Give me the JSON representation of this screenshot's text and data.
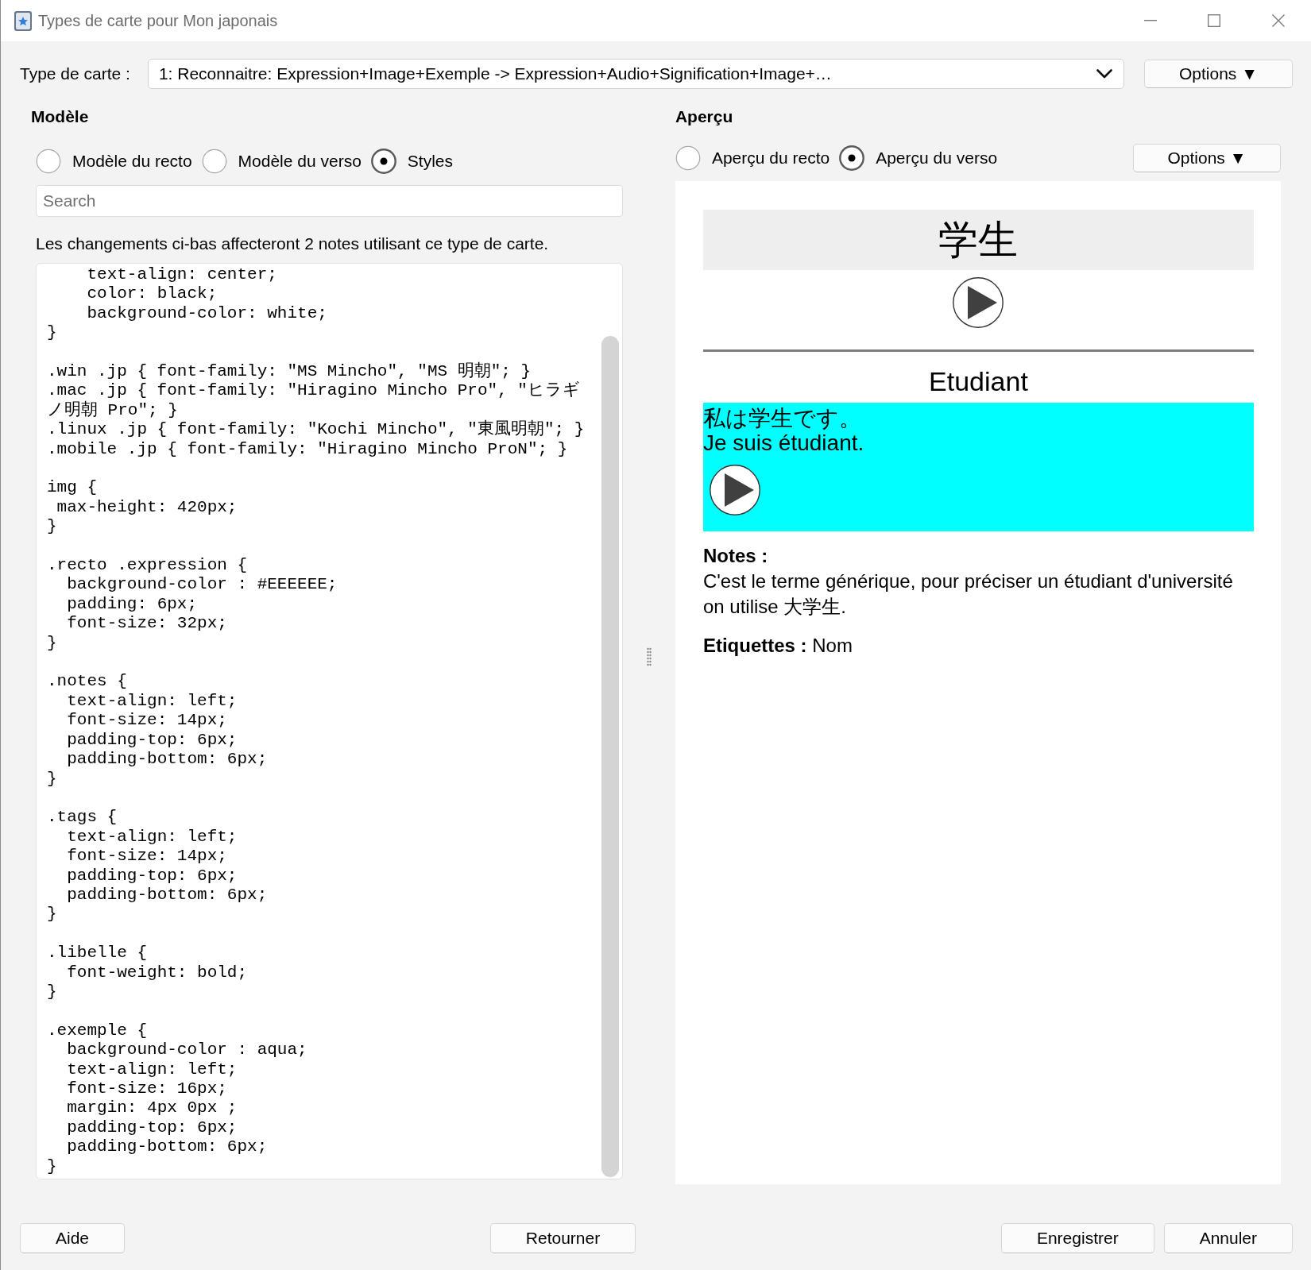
{
  "window": {
    "title": "Types de carte pour Mon japonais"
  },
  "card_type": {
    "label": "Type de carte :",
    "value": "1: Reconnaitre: Expression+Image+Exemple -> Expression+Audio+Signification+Image+…",
    "options_button": "Options ▼"
  },
  "template": {
    "heading": "Modèle",
    "modes": [
      {
        "label": "Modèle du recto",
        "selected": false
      },
      {
        "label": "Modèle du verso",
        "selected": false
      },
      {
        "label": "Styles",
        "selected": true
      }
    ],
    "search": {
      "placeholder": "Search"
    },
    "info": "Les changements ci-bas affecteront 2 notes utilisant ce type de carte.",
    "code_blocks": [
      [
        "    text-align: center;",
        "    color: black;",
        "    background-color: white;",
        "}"
      ],
      [
        ".win .jp { font-family: \"MS Mincho\", \"MS 明朝\"; }",
        ".mac .jp { font-family: \"Hiragino Mincho Pro\", \"ヒラギノ明朝 Pro\"; }",
        ".linux .jp { font-family: \"Kochi Mincho\", \"東風明朝\"; }",
        ".mobile .jp { font-family: \"Hiragino Mincho ProN\"; }"
      ],
      [
        "img {",
        " max-height: 420px;",
        "}"
      ],
      [
        ".recto .expression {",
        "  background-color : #EEEEEE;",
        "  padding: 6px;",
        "  font-size: 32px;",
        "}"
      ],
      [
        ".notes {",
        "  text-align: left;",
        "  font-size: 14px;",
        "  padding-top: 6px;",
        "  padding-bottom: 6px;",
        "}"
      ],
      [
        ".tags {",
        "  text-align: left;",
        "  font-size: 14px;",
        "  padding-top: 6px;",
        "  padding-bottom: 6px;",
        "}"
      ],
      [
        ".libelle {",
        "  font-weight: bold;",
        "}"
      ],
      [
        ".exemple {",
        "  background-color : aqua;",
        "  text-align: left;",
        "  font-size: 16px;",
        "  margin: 4px 0px ;",
        "  padding-top: 6px;",
        "  padding-bottom: 6px;",
        "}"
      ]
    ]
  },
  "preview": {
    "heading": "Aperçu",
    "modes": [
      {
        "label": "Aperçu du recto",
        "selected": false
      },
      {
        "label": "Aperçu du verso",
        "selected": true
      }
    ],
    "options_button": "Options ▼",
    "card": {
      "expression": "学生",
      "meaning": "Etudiant",
      "example_jp": "私は学生です。",
      "example_fr": "Je suis étudiant.",
      "notes_label": "Notes :",
      "notes": "C'est le terme générique, pour préciser un étudiant d'université on utilise 大学生.",
      "tags": "**Etiquettes :** Nom"
    }
  },
  "footer": {
    "left": [
      "Aide"
    ],
    "center": [
      "Retourner"
    ],
    "right": [
      "Enregistrer",
      "Annuler"
    ]
  }
}
